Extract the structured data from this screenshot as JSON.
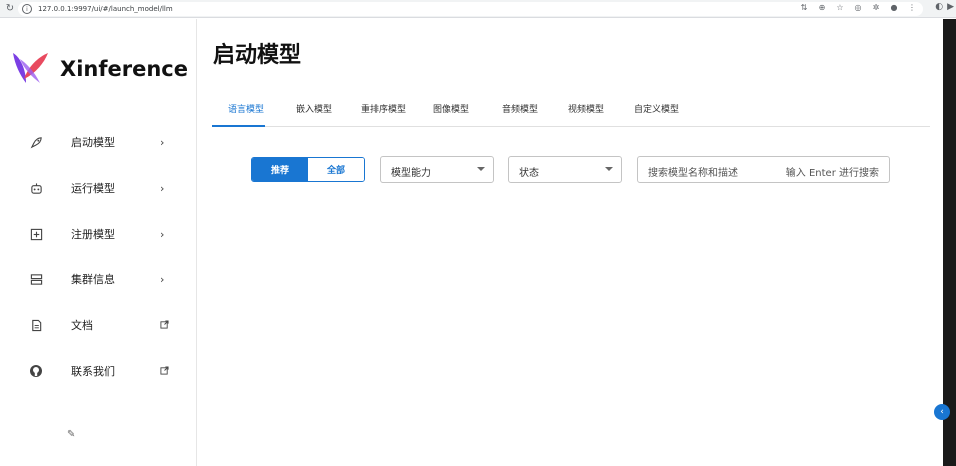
{
  "browser": {
    "url": "127.0.0.1:9997/ui/#/launch_model/llm"
  },
  "app": {
    "name": "Xinference"
  },
  "sidebar": {
    "items": [
      {
        "label": "启动模型",
        "icon": "rocket-icon",
        "trailing": "chevron-right-icon"
      },
      {
        "label": "运行模型",
        "icon": "robot-icon",
        "trailing": "chevron-right-icon"
      },
      {
        "label": "注册模型",
        "icon": "add-box-icon",
        "trailing": "chevron-right-icon"
      },
      {
        "label": "集群信息",
        "icon": "server-icon",
        "trailing": "chevron-right-icon"
      },
      {
        "label": "文档",
        "icon": "document-icon",
        "trailing": "external-link-icon"
      },
      {
        "label": "联系我们",
        "icon": "github-icon",
        "trailing": "external-link-icon"
      }
    ]
  },
  "main": {
    "title": "启动模型",
    "tabs": [
      {
        "label": "语言模型",
        "active": true
      },
      {
        "label": "嵌入模型",
        "active": false
      },
      {
        "label": "重排序模型",
        "active": false
      },
      {
        "label": "图像模型",
        "active": false
      },
      {
        "label": "音频模型",
        "active": false
      },
      {
        "label": "视频模型",
        "active": false
      },
      {
        "label": "自定义模型",
        "active": false
      }
    ],
    "filter_toggle": {
      "recommended": "推荐",
      "all": "全部",
      "selected": "推荐"
    },
    "ability_select": {
      "label": "模型能力"
    },
    "status_select": {
      "label": "状态"
    },
    "search": {
      "placeholder": "搜索模型名称和描述",
      "hint": "输入 Enter 进行搜索"
    }
  },
  "colors": {
    "accent": "#1976d2",
    "logo_primary": "#7b3fe4",
    "logo_secondary": "#e84a5f"
  }
}
